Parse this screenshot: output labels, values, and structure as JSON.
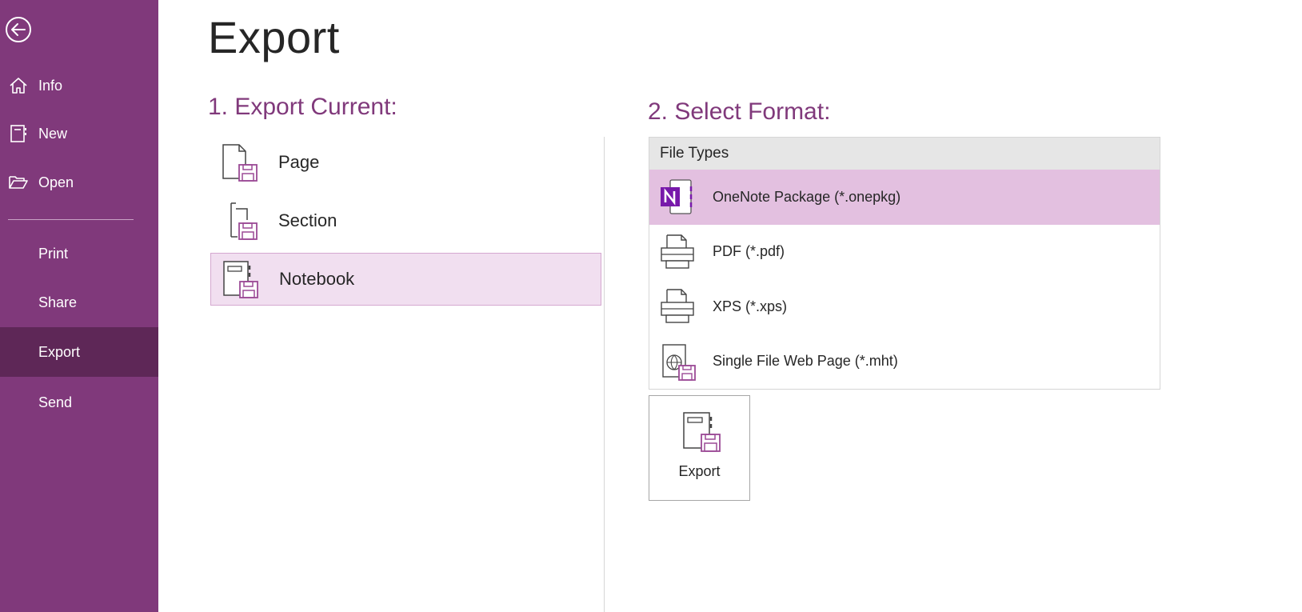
{
  "sidebar": {
    "back_icon": "back-arrow-icon",
    "items": [
      {
        "label": "Info",
        "icon": "home-icon"
      },
      {
        "label": "New",
        "icon": "new-notebook-icon"
      },
      {
        "label": "Open",
        "icon": "folder-open-icon"
      },
      {
        "label": "Print"
      },
      {
        "label": "Share"
      },
      {
        "label": "Export",
        "selected": true
      },
      {
        "label": "Send"
      }
    ]
  },
  "main": {
    "title": "Export",
    "export_current": {
      "heading": "1. Export Current:",
      "options": [
        {
          "label": "Page",
          "icon": "page-save-icon"
        },
        {
          "label": "Section",
          "icon": "section-save-icon"
        },
        {
          "label": "Notebook",
          "icon": "notebook-save-icon",
          "selected": true
        }
      ]
    },
    "select_format": {
      "heading": "2. Select Format:",
      "header": "File Types",
      "types": [
        {
          "label": "OneNote Package (*.onepkg)",
          "icon": "onenote-icon",
          "selected": true
        },
        {
          "label": "PDF (*.pdf)",
          "icon": "printer-icon"
        },
        {
          "label": "XPS (*.xps)",
          "icon": "printer-icon"
        },
        {
          "label": "Single File Web Page (*.mht)",
          "icon": "web-page-save-icon"
        }
      ]
    },
    "export_button": {
      "label": "Export",
      "icon": "notebook-save-icon"
    }
  },
  "colors": {
    "accent": "#80397b",
    "sidebar_selected": "#5e2757",
    "row_selected": "#e3c0e0",
    "scope_selected": "#f1dff0"
  }
}
